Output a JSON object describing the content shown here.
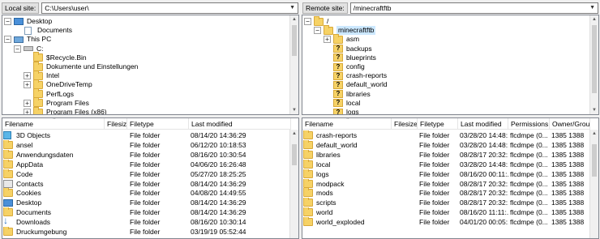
{
  "local": {
    "site_label": "Local site:",
    "path": "C:\\Users\\user\\",
    "tree": [
      {
        "label": "Desktop",
        "icon": "desktop-icon",
        "expander": "minus"
      },
      {
        "label": "Documents",
        "icon": "document-icon",
        "expander": "none"
      },
      {
        "label": "This PC",
        "icon": "computer-icon",
        "expander": "minus"
      },
      {
        "label": "C:",
        "icon": "drive-icon",
        "expander": "minus"
      },
      {
        "label": "$Recycle.Bin",
        "icon": "folder-icon",
        "expander": "none"
      },
      {
        "label": "Dokumente und Einstellungen",
        "icon": "folder-icon",
        "expander": "none"
      },
      {
        "label": "Intel",
        "icon": "folder-icon",
        "expander": "plus"
      },
      {
        "label": "OneDriveTemp",
        "icon": "folder-icon",
        "expander": "plus"
      },
      {
        "label": "PerfLogs",
        "icon": "folder-icon",
        "expander": "none"
      },
      {
        "label": "Program Files",
        "icon": "folder-icon",
        "expander": "plus"
      },
      {
        "label": "Program Files (x86)",
        "icon": "folder-icon",
        "expander": "plus"
      }
    ],
    "columns": [
      "Filename",
      "Filesize",
      "Filetype",
      "Last modified"
    ],
    "files": [
      {
        "name": "3D Objects",
        "size": "",
        "type": "File folder",
        "modified": "08/14/20 14:36:29",
        "icon": "3d-objects-icon"
      },
      {
        "name": "ansel",
        "size": "",
        "type": "File folder",
        "modified": "06/12/20 10:18:53",
        "icon": "folder-icon"
      },
      {
        "name": "Anwendungsdaten",
        "size": "",
        "type": "File folder",
        "modified": "08/16/20 10:30:54",
        "icon": "folder-icon"
      },
      {
        "name": "AppData",
        "size": "",
        "type": "File folder",
        "modified": "04/06/20 16:26:48",
        "icon": "folder-icon"
      },
      {
        "name": "Code",
        "size": "",
        "type": "File folder",
        "modified": "05/27/20 18:25:25",
        "icon": "folder-icon"
      },
      {
        "name": "Contacts",
        "size": "",
        "type": "File folder",
        "modified": "08/14/20 14:36:29",
        "icon": "contacts-icon"
      },
      {
        "name": "Cookies",
        "size": "",
        "type": "File folder",
        "modified": "04/08/20 14:49:55",
        "icon": "folder-icon"
      },
      {
        "name": "Desktop",
        "size": "",
        "type": "File folder",
        "modified": "08/14/20 14:36:29",
        "icon": "desktop-icon"
      },
      {
        "name": "Documents",
        "size": "",
        "type": "File folder",
        "modified": "08/14/20 14:36:29",
        "icon": "documents-folder-icon"
      },
      {
        "name": "Downloads",
        "size": "",
        "type": "File folder",
        "modified": "08/16/20 10:30:14",
        "icon": "download-icon"
      },
      {
        "name": "Druckumgebung",
        "size": "",
        "type": "File folder",
        "modified": "03/19/19 05:52:44",
        "icon": "folder-icon"
      }
    ]
  },
  "remote": {
    "site_label": "Remote site:",
    "path": "/minecraftftb",
    "tree": [
      {
        "label": "/",
        "icon": "folder-icon",
        "expander": "minus"
      },
      {
        "label": "minecraftftb",
        "icon": "folder-icon",
        "expander": "minus"
      },
      {
        "label": "asm",
        "icon": "folder-icon",
        "expander": "plus"
      },
      {
        "label": "backups",
        "icon": "question-folder-icon",
        "expander": "none"
      },
      {
        "label": "blueprints",
        "icon": "question-folder-icon",
        "expander": "none"
      },
      {
        "label": "config",
        "icon": "question-folder-icon",
        "expander": "none"
      },
      {
        "label": "crash-reports",
        "icon": "question-folder-icon",
        "expander": "none"
      },
      {
        "label": "default_world",
        "icon": "question-folder-icon",
        "expander": "none"
      },
      {
        "label": "libraries",
        "icon": "question-folder-icon",
        "expander": "none"
      },
      {
        "label": "local",
        "icon": "question-folder-icon",
        "expander": "none"
      },
      {
        "label": "logs",
        "icon": "question-folder-icon",
        "expander": "none"
      }
    ],
    "columns": [
      "Filename",
      "Filesize",
      "Filetype",
      "Last modified",
      "Permissions",
      "Owner/Group"
    ],
    "files": [
      {
        "name": "crash-reports",
        "size": "",
        "type": "File folder",
        "modified": "03/28/20 14:48:...",
        "perms": "flcdmpe (0...",
        "owner": "1385 1388"
      },
      {
        "name": "default_world",
        "size": "",
        "type": "File folder",
        "modified": "03/28/20 14:48:...",
        "perms": "flcdmpe (0...",
        "owner": "1385 1388"
      },
      {
        "name": "libraries",
        "size": "",
        "type": "File folder",
        "modified": "08/28/17 20:32:...",
        "perms": "flcdmpe (0...",
        "owner": "1385 1388"
      },
      {
        "name": "local",
        "size": "",
        "type": "File folder",
        "modified": "03/28/20 14:48:...",
        "perms": "flcdmpe (0...",
        "owner": "1385 1388"
      },
      {
        "name": "logs",
        "size": "",
        "type": "File folder",
        "modified": "08/16/20 00:11:...",
        "perms": "flcdmpe (0...",
        "owner": "1385 1388"
      },
      {
        "name": "modpack",
        "size": "",
        "type": "File folder",
        "modified": "08/28/17 20:32:...",
        "perms": "flcdmpe (0...",
        "owner": "1385 1388"
      },
      {
        "name": "mods",
        "size": "",
        "type": "File folder",
        "modified": "08/28/17 20:32:...",
        "perms": "flcdmpe (0...",
        "owner": "1385 1388"
      },
      {
        "name": "scripts",
        "size": "",
        "type": "File folder",
        "modified": "08/28/17 20:32:...",
        "perms": "flcdmpe (0...",
        "owner": "1385 1388"
      },
      {
        "name": "world",
        "size": "",
        "type": "File folder",
        "modified": "08/16/20 11:11:...",
        "perms": "flcdmpe (0...",
        "owner": "1385 1388"
      },
      {
        "name": "world_exploded",
        "size": "",
        "type": "File folder",
        "modified": "04/01/20 00:05:...",
        "perms": "flcdmpe (0...",
        "owner": "1385 1388"
      }
    ]
  },
  "colors": {
    "selection": "#cce8ff",
    "folder": "#f6d266"
  }
}
